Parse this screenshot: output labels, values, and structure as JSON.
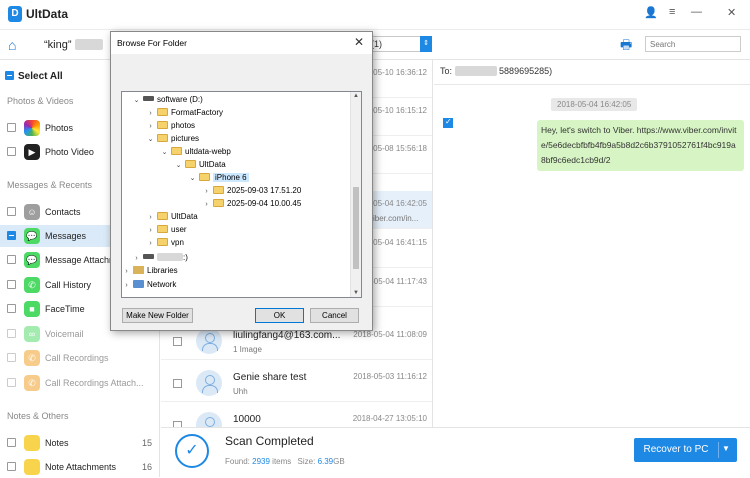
{
  "app": {
    "title": "UltData",
    "logo_letter": "D"
  },
  "window": {
    "user_icon": "user-icon",
    "menu_icon": "menu-icon",
    "minimize": "—",
    "close": "✕",
    "menu": "≡"
  },
  "toolbar": {
    "contact": "“king”",
    "dropdown_value": "(1)",
    "search_placeholder": "Search"
  },
  "sidebar": {
    "select_all": "Select All",
    "sections": {
      "photos_videos": "Photos & Videos",
      "messages_recents": "Messages & Recents",
      "notes_others": "Notes & Others"
    },
    "items": [
      {
        "label": "Photos",
        "icon": "photos-icon",
        "color": "#f2a93b"
      },
      {
        "label": "Photo Video",
        "icon": "video-icon",
        "color": "#222222"
      },
      {
        "label": "Contacts",
        "icon": "contacts-icon",
        "color": "#9e9e9e"
      },
      {
        "label": "Messages",
        "icon": "messages-icon",
        "color": "#4cd964"
      },
      {
        "label": "Message Attachm...",
        "icon": "message-attachment-icon",
        "color": "#4cd964"
      },
      {
        "label": "Call History",
        "icon": "phone-icon",
        "color": "#4cd964"
      },
      {
        "label": "FaceTime",
        "icon": "facetime-icon",
        "color": "#4cd964"
      },
      {
        "label": "Voicemail",
        "icon": "voicemail-icon",
        "color": "#4cd964"
      },
      {
        "label": "Call Recordings",
        "icon": "call-recording-icon",
        "color": "#f2a93b"
      },
      {
        "label": "Call Recordings Attach...",
        "icon": "call-recording-attach-icon",
        "color": "#f2a93b"
      },
      {
        "label": "Notes",
        "icon": "notes-icon",
        "color": "#f7d44c",
        "count": "15"
      },
      {
        "label": "Note Attachments",
        "icon": "note-attachment-icon",
        "color": "#f7d44c",
        "count": "16"
      }
    ]
  },
  "list": {
    "rows": [
      {
        "name": "",
        "sub": "",
        "time": "2018-05-10 16:36:12"
      },
      {
        "name": "",
        "sub": "",
        "time": "2018-05-10 16:15:12"
      },
      {
        "name": "",
        "sub": "",
        "time": "2018-05-08 15:56:18"
      },
      {
        "name": "",
        "sub": "viber.com/in...",
        "time": "2018-05-04 16:42:05"
      },
      {
        "name": "",
        "sub": "",
        "time": "2018-05-04 16:41:15"
      },
      {
        "name": "",
        "sub": "",
        "time": "2018-05-04 11:17:43"
      },
      {
        "name": "liulingfang4@163.com...",
        "sub": "1 Image",
        "time": "2018-05-04 11:08:09"
      },
      {
        "name": "Genie share test",
        "sub": "Uhh",
        "time": "2018-05-03 11:16:12"
      },
      {
        "name": "10000",
        "sub": "",
        "time": "2018-04-27 13:05:10"
      }
    ]
  },
  "detail": {
    "to_label": "To:",
    "to_number": "5889695285)",
    "timestamp": "2018-05-04 16:42:05",
    "message": "Hey, let's switch to Viber. https://www.viber.com/invite/5e6decbfbfb4fb9a5b8d2c6b3791052761f4bc919a8bf9c6edc1cb9d/2"
  },
  "scan": {
    "title": "Scan Completed",
    "found_label": "Found:",
    "found_count": "2939",
    "items_label": "items",
    "size_label": "Size:",
    "size_value": "6.39",
    "size_unit": "GB",
    "recover_label": "Recover to PC"
  },
  "dialog": {
    "title": "Browse For Folder",
    "tree": [
      {
        "label": "software (D:)",
        "type": "drive",
        "expander": "⌄",
        "level": 0
      },
      {
        "label": "FormatFactory",
        "type": "folder",
        "expander": "›",
        "level": 1
      },
      {
        "label": "photos",
        "type": "folder",
        "expander": "›",
        "level": 1
      },
      {
        "label": "pictures",
        "type": "folder",
        "expander": "⌄",
        "level": 1
      },
      {
        "label": "ultdata-webp",
        "type": "folder",
        "expander": "⌄",
        "level": 2
      },
      {
        "label": "UltData",
        "type": "folder",
        "expander": "⌄",
        "level": 3
      },
      {
        "label": "iPhone 6",
        "type": "folder",
        "expander": "⌄",
        "level": 4,
        "selected": true
      },
      {
        "label": "2025-09-03 17.51.20",
        "type": "folder",
        "expander": "›",
        "level": 5
      },
      {
        "label": "2025-09-04 10.00.45",
        "type": "folder",
        "expander": "›",
        "level": 5
      },
      {
        "label": "UltData",
        "type": "folder",
        "expander": "›",
        "level": 1
      },
      {
        "label": "user",
        "type": "folder",
        "expander": "›",
        "level": 1
      },
      {
        "label": "vpn",
        "type": "folder",
        "expander": "›",
        "level": 1
      },
      {
        "label": ":)",
        "type": "drive",
        "expander": "›",
        "level": 0
      },
      {
        "label": "Libraries",
        "type": "library",
        "expander": "›",
        "level": -1
      },
      {
        "label": "Network",
        "type": "network",
        "expander": "›",
        "level": -1
      }
    ],
    "make_new_folder": "Make New Folder",
    "ok": "OK",
    "cancel": "Cancel"
  },
  "colors": {
    "accent": "#1e88e5",
    "bubble": "#d7f5c4",
    "selected_row": "#e6f0fb"
  }
}
